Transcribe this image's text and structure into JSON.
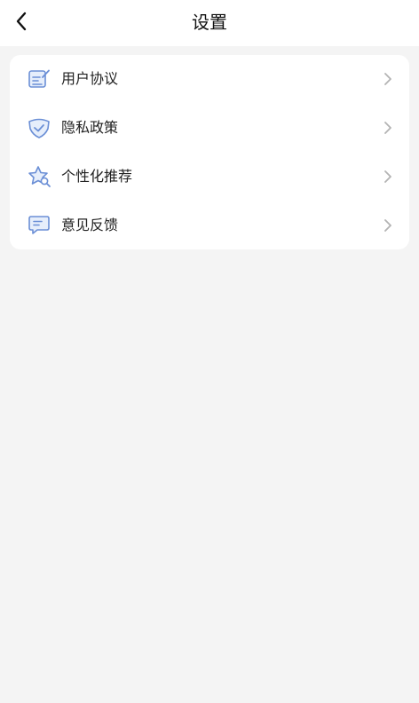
{
  "header": {
    "title": "设置",
    "back_icon": "chevron-left-icon"
  },
  "menu": {
    "items": [
      {
        "label": "用户协议",
        "icon": "document-edit-icon"
      },
      {
        "label": "隐私政策",
        "icon": "shield-check-icon"
      },
      {
        "label": "个性化推荐",
        "icon": "star-search-icon"
      },
      {
        "label": "意见反馈",
        "icon": "message-icon"
      }
    ]
  },
  "colors": {
    "icon_accent": "#6b8fd6",
    "icon_fill": "#e6eefb",
    "chevron": "#b3b3b3",
    "background": "#f4f4f4",
    "card": "#ffffff"
  }
}
